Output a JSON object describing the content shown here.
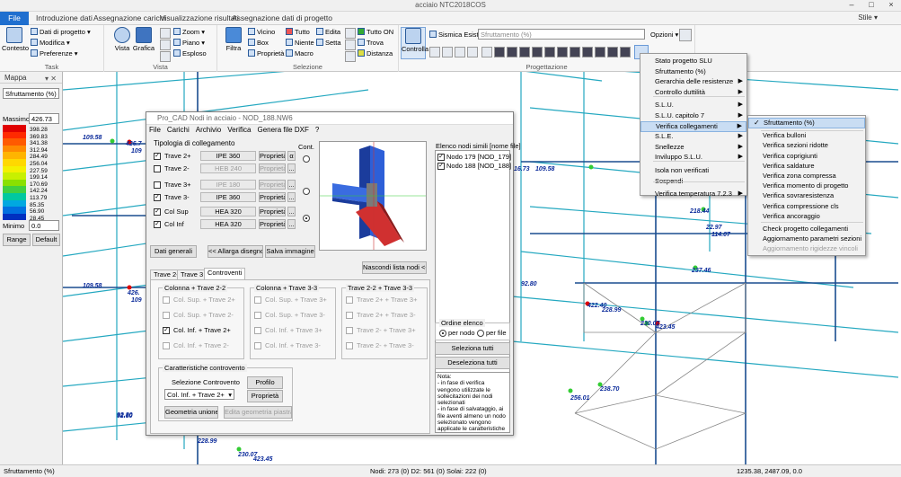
{
  "window": {
    "title": "acciaio NTC2018COS",
    "minimize": "–",
    "maximize": "□",
    "close": "×"
  },
  "tabs": [
    "File",
    "Introduzione dati",
    "Assegnazione carichi",
    "Visualizzazione risultati",
    "Assegnazione dati di progetto"
  ],
  "stile_label": "Stile ▾",
  "ribbon": {
    "task": {
      "label": "Task",
      "contesto": "Contesto",
      "dati_progetto": "Dati di progetto ▾",
      "modifica": "Modifica ▾",
      "preferenze": "Preferenze ▾"
    },
    "vista": {
      "label": "Vista",
      "vista": "Vista",
      "grafica": "Grafica",
      "zoom": "Zoom ▾",
      "piano": "Piano ▾",
      "esploso": "Esploso"
    },
    "selezione": {
      "label": "Selezione",
      "filtra": "Filtra",
      "vicino": "Vicino",
      "box": "Box",
      "proprieta": "Proprietà ▾",
      "tutto": "Tutto",
      "niente": "Niente",
      "macro": "Macro",
      "edita": "Edita",
      "setta": "Setta",
      "tutto_on": "Tutto ON",
      "trova": "Trova",
      "distanza": "Distanza"
    },
    "progettazione": {
      "label": "Progettazione",
      "controlla": "Controlla",
      "sismica": "Sismica Esist.",
      "combo": "Sfruttamento (%)",
      "opzioni": "Opzioni ▾"
    }
  },
  "mappa": {
    "title": "Mappa",
    "combo": "Sfruttamento (%)",
    "massimo_label": "Massimo",
    "massimo_value": "426.73",
    "scale": [
      "398.28",
      "369.83",
      "341.38",
      "312.94",
      "284.49",
      "256.04",
      "227.59",
      "199.14",
      "170.69",
      "142.24",
      "113.79",
      "85.35",
      "56.90",
      "28.45"
    ],
    "minimo_label": "Minimo",
    "minimo_value": "0.0",
    "range_btn": "Range",
    "default_btn": "Default",
    "colors": [
      "#e00000",
      "#ff2a00",
      "#ff5a00",
      "#ff8a00",
      "#ffb400",
      "#ffd800",
      "#f4f000",
      "#c8f000",
      "#8ae000",
      "#40d040",
      "#00c8a0",
      "#00a8e0",
      "#0070e0",
      "#0030c0"
    ]
  },
  "drawing_labels": [
    {
      "text": "109.58",
      "bind": "a"
    },
    {
      "text": "426.7",
      "bind": "b"
    },
    {
      "text": "109",
      "bind": "c"
    },
    {
      "text": "109.58",
      "bind": "d"
    },
    {
      "text": "426.",
      "bind": "e"
    },
    {
      "text": "109",
      "bind": "f"
    },
    {
      "text": "92.80",
      "bind": "g"
    },
    {
      "text": "228.99",
      "bind": "h"
    },
    {
      "text": "230.07",
      "bind": "i"
    },
    {
      "text": "423.45",
      "bind": "j"
    },
    {
      "text": "16.73",
      "bind": "k"
    },
    {
      "text": "109.58",
      "bind": "l"
    },
    {
      "text": "92.80",
      "bind": "m"
    },
    {
      "text": "422.40",
      "bind": "n"
    },
    {
      "text": "228.99",
      "bind": "o"
    },
    {
      "text": "230.07",
      "bind": "p"
    },
    {
      "text": "423.45",
      "bind": "q"
    },
    {
      "text": "256.01",
      "bind": "r"
    },
    {
      "text": "238.70",
      "bind": "s"
    },
    {
      "text": "92.80",
      "bind": "t"
    },
    {
      "text": "218.44",
      "bind": "u"
    },
    {
      "text": "22.97",
      "bind": "v"
    },
    {
      "text": "114.07",
      "bind": "w"
    },
    {
      "text": "237.46",
      "bind": "x"
    }
  ],
  "dialog": {
    "title": "Pro_CAD Nodi in acciaio - NOD_188.NW6",
    "menu": [
      "File",
      "Carichi",
      "Archivio",
      "Verifica",
      "Genera file DXF",
      "?"
    ],
    "tipologia_title": "Tipologia di collegamento",
    "cont_label": "Cont.",
    "rows": [
      {
        "label": "Trave 2+",
        "section": "IPE 360",
        "checked": "✓"
      },
      {
        "label": "Trave 2-",
        "section": "HEB 240",
        "checked": ""
      },
      {
        "label": "Trave 3+",
        "section": "IPE 180",
        "checked": ""
      },
      {
        "label": "Trave 3-",
        "section": "IPE 360",
        "checked": "✓"
      },
      {
        "label": "Col Sup",
        "section": "HEA 320",
        "checked": "✓"
      },
      {
        "label": "Col Inf",
        "section": "HEA 320",
        "checked": "✓"
      }
    ],
    "prop_btn": "Proprietà",
    "alpha": "α",
    "dots": "...",
    "dati_generali": "Dati generali",
    "allarga": "<< Allarga disegno",
    "salva": "Salva immagine",
    "elenco_title": "Elenco nodi simili [nome file]",
    "nodi": [
      "Nodo 179 [NOD_179]",
      "Nodo 188 [NOD_188]"
    ],
    "nascondi": "Nascondi lista nodi  <<",
    "tabs": [
      "Trave 2+",
      "Trave 3",
      "Controventi"
    ],
    "g1_title": "Colonna + Trave 2-2",
    "g2_title": "Colonna + Trave 3-3",
    "g3_title": "Trave 2-2 + Trave 3-3",
    "g1": [
      "Col. Sup. + Trave 2+",
      "Col. Sup. + Trave 2-",
      "Col. Inf. + Trave 2+",
      "Col. Inf. + Trave 2-"
    ],
    "g2": [
      "Col. Sup. + Trave 3+",
      "Col. Sup. + Trave 3-",
      "Col. Inf. + Trave 3+",
      "Col. Inf. + Trave 3-"
    ],
    "g3": [
      "Trave 2+ + Trave 3+",
      "Trave 2+ + Trave 3-",
      "Trave 2- + Trave 3+",
      "Trave 2- + Trave 3-"
    ],
    "caratt_title": "Caratteristiche controvento",
    "sel_controvento": "Selezione Controvento",
    "combo_value": "Col. Inf. + Trave 2+",
    "profilo": "Profilo",
    "proprieta": "Proprietà",
    "geometria": "Geometria unione",
    "edita_geom": "Edita geometria piastra",
    "ordine_title": "Ordine elenco",
    "per_nodo": "per nodo",
    "per_file": "per file",
    "seleziona": "Seleziona tutti",
    "deseleziona": "Deseleziona tutti",
    "nota": "Nota:\n- in fase di verifica vengono utilizzate le sollecitazioni dei nodi selezionati\n- in fase di salvataggio, ai file aventi almeno un nodo selezionato vengono applicate le caratteristiche correnti."
  },
  "menu1": {
    "items": [
      "Stato progetto SLU",
      "Sfruttamento (%)",
      "Gerarchia delle resistenze",
      "Controllo duttilità",
      "S.L.U.",
      "S.L.U. capitolo 7",
      "Verifica collegamenti",
      "S.L.E.",
      "Snellezze",
      "Inviluppo S.L.U.",
      "Isola non verificati",
      "Sospendi",
      "Verifica temperatura 7.2.3"
    ]
  },
  "menu2": {
    "items": [
      "Sfruttamento (%)",
      "Verifica bulloni",
      "Verifica sezioni ridotte",
      "Verifica coprigiunti",
      "Verifica saldature",
      "Verifica zona compressa",
      "Verifica momento di progetto",
      "Verifica sovraresistenza",
      "Verifica compressione cls",
      "Verifica ancoraggio",
      "Check progetto collegamenti",
      "Aggiornamento parametri sezioni",
      "Aggiornamento rigidezze vincoli"
    ],
    "check": "✓"
  },
  "status": {
    "left": "Sfruttamento (%)",
    "center": "Nodi: 273 (0) D2: 561 (0) Solai: 222 (0)",
    "right": "1235.38, 2487.09, 0.0"
  }
}
